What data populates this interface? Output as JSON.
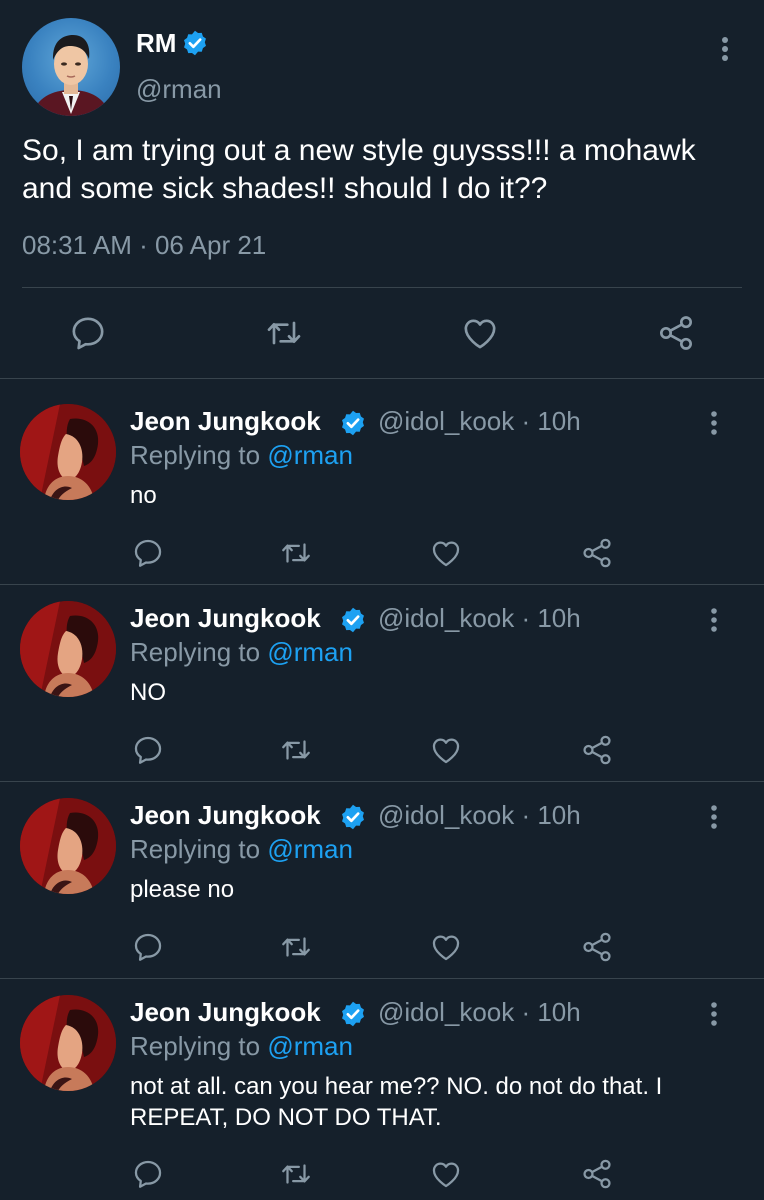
{
  "colors": {
    "background": "#15202b",
    "divider": "#38444d",
    "secondary_text": "#8899a6",
    "accent": "#1da1f2",
    "primary_text": "#ffffff"
  },
  "main_tweet": {
    "display_name": "RM",
    "handle": "@rman",
    "text": "So, I am trying out a new style guysss!!! a mohawk and some sick shades!! should I do it??",
    "timestamp": "08:31 AM · 06 Apr 21",
    "verified_icon": "verified-badge-icon",
    "actions": [
      "reply-icon",
      "retweet-icon",
      "like-icon",
      "share-icon"
    ]
  },
  "replies": [
    {
      "display_name": "Jeon Jungkook",
      "meta": "@idol_kook · 10h",
      "replying_prefix": "Replying to ",
      "replying_to": "@rman",
      "text": "no"
    },
    {
      "display_name": "Jeon Jungkook",
      "meta": "@idol_kook · 10h",
      "replying_prefix": "Replying to ",
      "replying_to": "@rman",
      "text": "NO"
    },
    {
      "display_name": "Jeon Jungkook",
      "meta": "@idol_kook · 10h",
      "replying_prefix": "Replying to ",
      "replying_to": "@rman",
      "text": "please no"
    },
    {
      "display_name": "Jeon Jungkook",
      "meta": "@idol_kook · 10h",
      "replying_prefix": "Replying to ",
      "replying_to": "@rman",
      "text": "not at all. can you hear me?? NO. do not do that. I REPEAT, DO NOT DO THAT."
    }
  ]
}
